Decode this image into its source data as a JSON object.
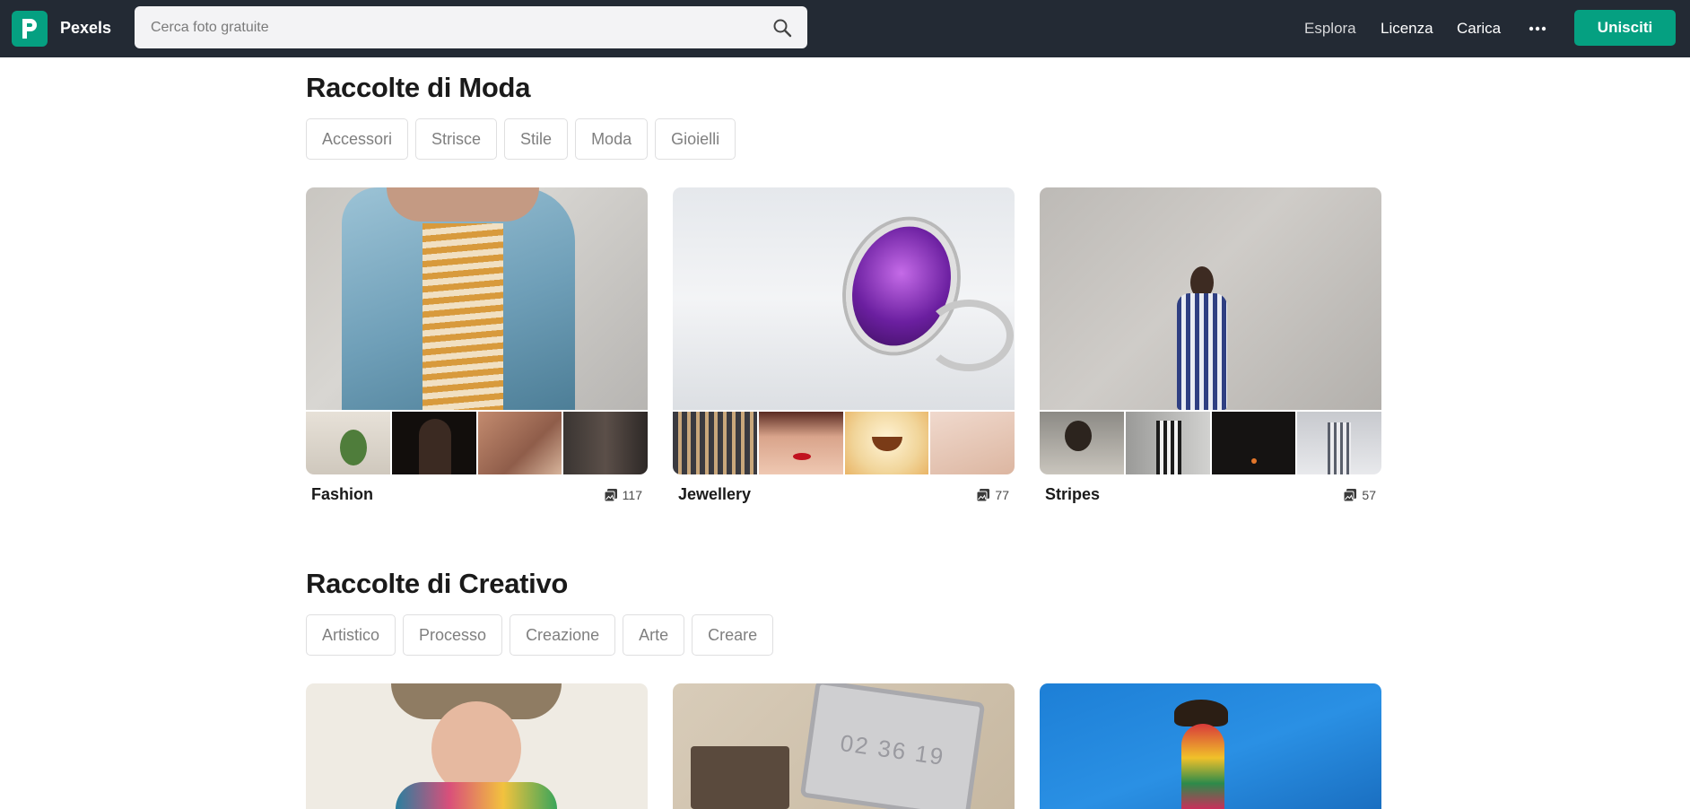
{
  "nav": {
    "brand": "Pexels",
    "search_placeholder": "Cerca foto gratuite",
    "links": [
      "Esplora",
      "Licenza",
      "Carica"
    ],
    "join_label": "Unisciti",
    "colors": {
      "bar": "#232a34",
      "accent": "#05a081"
    },
    "icons": [
      "pexels-logo-icon",
      "search-icon",
      "more-icon"
    ]
  },
  "sections": [
    {
      "title": "Raccolte di Moda",
      "tags": [
        "Accessori",
        "Strisce",
        "Stile",
        "Moda",
        "Gioielli"
      ],
      "collections": [
        {
          "title": "Fashion",
          "count": "117"
        },
        {
          "title": "Jewellery",
          "count": "77"
        },
        {
          "title": "Stripes",
          "count": "57"
        }
      ]
    },
    {
      "title": "Raccolte di Creativo",
      "tags": [
        "Artistico",
        "Processo",
        "Creazione",
        "Arte",
        "Creare"
      ],
      "collections": [
        {
          "title": "",
          "count": ""
        },
        {
          "title": "",
          "count": ""
        },
        {
          "title": "",
          "count": ""
        }
      ],
      "laptop_clock": "02 36 19"
    }
  ]
}
